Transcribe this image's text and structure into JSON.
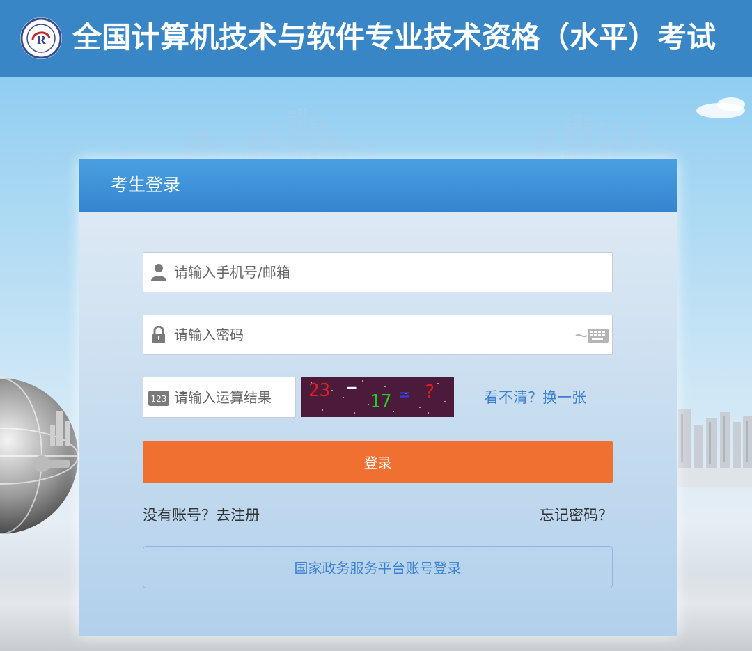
{
  "header": {
    "title": "全国计算机技术与软件专业技术资格（水平）考试"
  },
  "login": {
    "title": "考生登录",
    "username_placeholder": "请输入手机号/邮箱",
    "password_placeholder": "请输入密码",
    "captcha_placeholder": "请输入运算结果",
    "captcha": {
      "a": "23",
      "op": "−",
      "b": "17",
      "eq": "=",
      "q": "?"
    },
    "refresh_link": "看不清？换一张",
    "login_button": "登录",
    "register_link": "没有账号？去注册",
    "forgot_link": "忘记密码？",
    "gov_login_button": "国家政务服务平台账号登录"
  },
  "icons": {
    "logo": "exam-logo-icon",
    "username": "user-icon",
    "password": "lock-icon",
    "keyboard": "keyboard-icon",
    "captcha": "number-123-icon"
  },
  "colors": {
    "header_bg": "#3886c6",
    "card_header_bg": "#3584cf",
    "primary_button": "#f07032",
    "link": "#3a7fd0"
  }
}
